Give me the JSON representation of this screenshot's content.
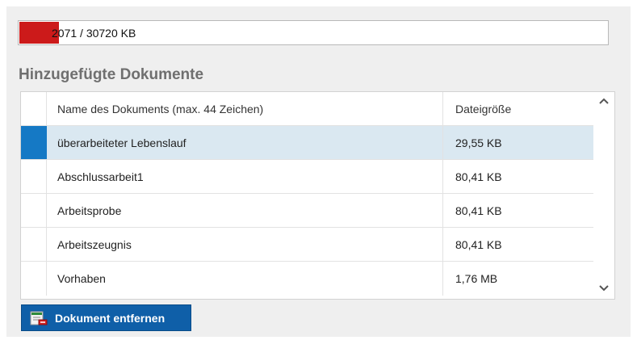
{
  "quota": {
    "text": "2071 / 30720 KB",
    "used_kb": 2071,
    "total_kb": 30720,
    "fill_color": "#cc1a1a"
  },
  "section_title": "Hinzugefügte Dokumente",
  "table": {
    "columns": [
      "Name des Dokuments (max. 44 Zeichen)",
      "Dateigröße"
    ],
    "rows": [
      {
        "name": "überarbeiteter Lebenslauf",
        "size": "29,55 KB",
        "selected": true
      },
      {
        "name": "Abschlussarbeit1",
        "size": "80,41 KB",
        "selected": false
      },
      {
        "name": "Arbeitsprobe",
        "size": "80,41 KB",
        "selected": false
      },
      {
        "name": "Arbeitszeugnis",
        "size": "80,41 KB",
        "selected": false
      },
      {
        "name": "Vorhaben",
        "size": "1,76 MB",
        "selected": false
      }
    ],
    "selection_color": "#1579c5",
    "scroll_up_icon": "chevron-up-icon",
    "scroll_down_icon": "chevron-down-icon"
  },
  "remove_button": {
    "label": "Dokument entfernen",
    "icon": "document-remove-icon",
    "color": "#0f5fa8"
  }
}
